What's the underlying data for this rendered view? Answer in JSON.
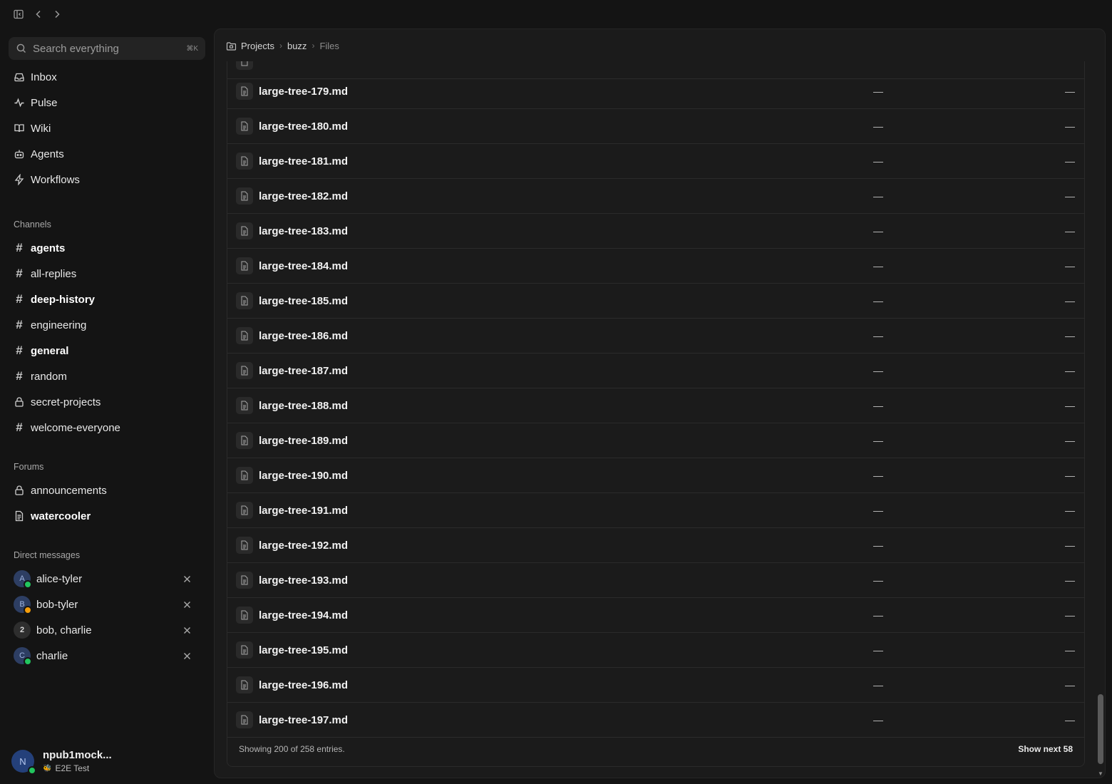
{
  "topbar": {
    "toggle_sidebar_icon": "sidebar-toggle-icon",
    "back_icon": "chevron-left-icon",
    "forward_icon": "chevron-right-icon"
  },
  "search": {
    "placeholder": "Search everything",
    "shortcut": "⌘K"
  },
  "nav": [
    {
      "label": "Inbox",
      "icon": "inbox-icon"
    },
    {
      "label": "Pulse",
      "icon": "pulse-icon"
    },
    {
      "label": "Wiki",
      "icon": "book-icon"
    },
    {
      "label": "Agents",
      "icon": "bot-icon"
    },
    {
      "label": "Workflows",
      "icon": "bolt-icon"
    }
  ],
  "channels_title": "Channels",
  "channels": [
    {
      "label": "agents",
      "bold": true,
      "icon": "hash-icon"
    },
    {
      "label": "all-replies",
      "bold": false,
      "icon": "hash-icon"
    },
    {
      "label": "deep-history",
      "bold": true,
      "icon": "hash-icon"
    },
    {
      "label": "engineering",
      "bold": false,
      "icon": "hash-icon"
    },
    {
      "label": "general",
      "bold": true,
      "icon": "hash-icon"
    },
    {
      "label": "random",
      "bold": false,
      "icon": "hash-icon"
    },
    {
      "label": "secret-projects",
      "bold": false,
      "icon": "lock-icon"
    },
    {
      "label": "welcome-everyone",
      "bold": false,
      "icon": "hash-icon"
    }
  ],
  "forums_title": "Forums",
  "forums": [
    {
      "label": "announcements",
      "bold": false,
      "icon": "lock-icon"
    },
    {
      "label": "watercooler",
      "bold": true,
      "icon": "document-icon"
    }
  ],
  "dms_title": "Direct messages",
  "dms": [
    {
      "label": "alice-tyler",
      "avatar": "A",
      "status_color": "#22c55e"
    },
    {
      "label": "bob-tyler",
      "avatar": "B",
      "status_color": "#f59e0b"
    },
    {
      "label": "bob, charlie",
      "avatar": "2",
      "status_color": ""
    },
    {
      "label": "charlie",
      "avatar": "C",
      "status_color": "#22c55e"
    }
  ],
  "user": {
    "avatar": "N",
    "name": "npub1mock...",
    "subtitle": "E2E Test",
    "badge_icon": "bee-icon"
  },
  "breadcrumb": {
    "items": [
      "Projects",
      "buzz",
      "Files"
    ]
  },
  "files": [
    {
      "name": "large-tree-179.md",
      "col_a": "—",
      "col_b": "—"
    },
    {
      "name": "large-tree-180.md",
      "col_a": "—",
      "col_b": "—"
    },
    {
      "name": "large-tree-181.md",
      "col_a": "—",
      "col_b": "—"
    },
    {
      "name": "large-tree-182.md",
      "col_a": "—",
      "col_b": "—"
    },
    {
      "name": "large-tree-183.md",
      "col_a": "—",
      "col_b": "—"
    },
    {
      "name": "large-tree-184.md",
      "col_a": "—",
      "col_b": "—"
    },
    {
      "name": "large-tree-185.md",
      "col_a": "—",
      "col_b": "—"
    },
    {
      "name": "large-tree-186.md",
      "col_a": "—",
      "col_b": "—"
    },
    {
      "name": "large-tree-187.md",
      "col_a": "—",
      "col_b": "—"
    },
    {
      "name": "large-tree-188.md",
      "col_a": "—",
      "col_b": "—"
    },
    {
      "name": "large-tree-189.md",
      "col_a": "—",
      "col_b": "—"
    },
    {
      "name": "large-tree-190.md",
      "col_a": "—",
      "col_b": "—"
    },
    {
      "name": "large-tree-191.md",
      "col_a": "—",
      "col_b": "—"
    },
    {
      "name": "large-tree-192.md",
      "col_a": "—",
      "col_b": "—"
    },
    {
      "name": "large-tree-193.md",
      "col_a": "—",
      "col_b": "—"
    },
    {
      "name": "large-tree-194.md",
      "col_a": "—",
      "col_b": "—"
    },
    {
      "name": "large-tree-195.md",
      "col_a": "—",
      "col_b": "—"
    },
    {
      "name": "large-tree-196.md",
      "col_a": "—",
      "col_b": "—"
    },
    {
      "name": "large-tree-197.md",
      "col_a": "—",
      "col_b": "—"
    }
  ],
  "footer": {
    "status": "Showing 200 of 258 entries.",
    "next_label": "Show next 58"
  },
  "colors": {
    "background": "#141414",
    "panel": "#1b1b1b",
    "online": "#22c55e",
    "away": "#f59e0b"
  }
}
